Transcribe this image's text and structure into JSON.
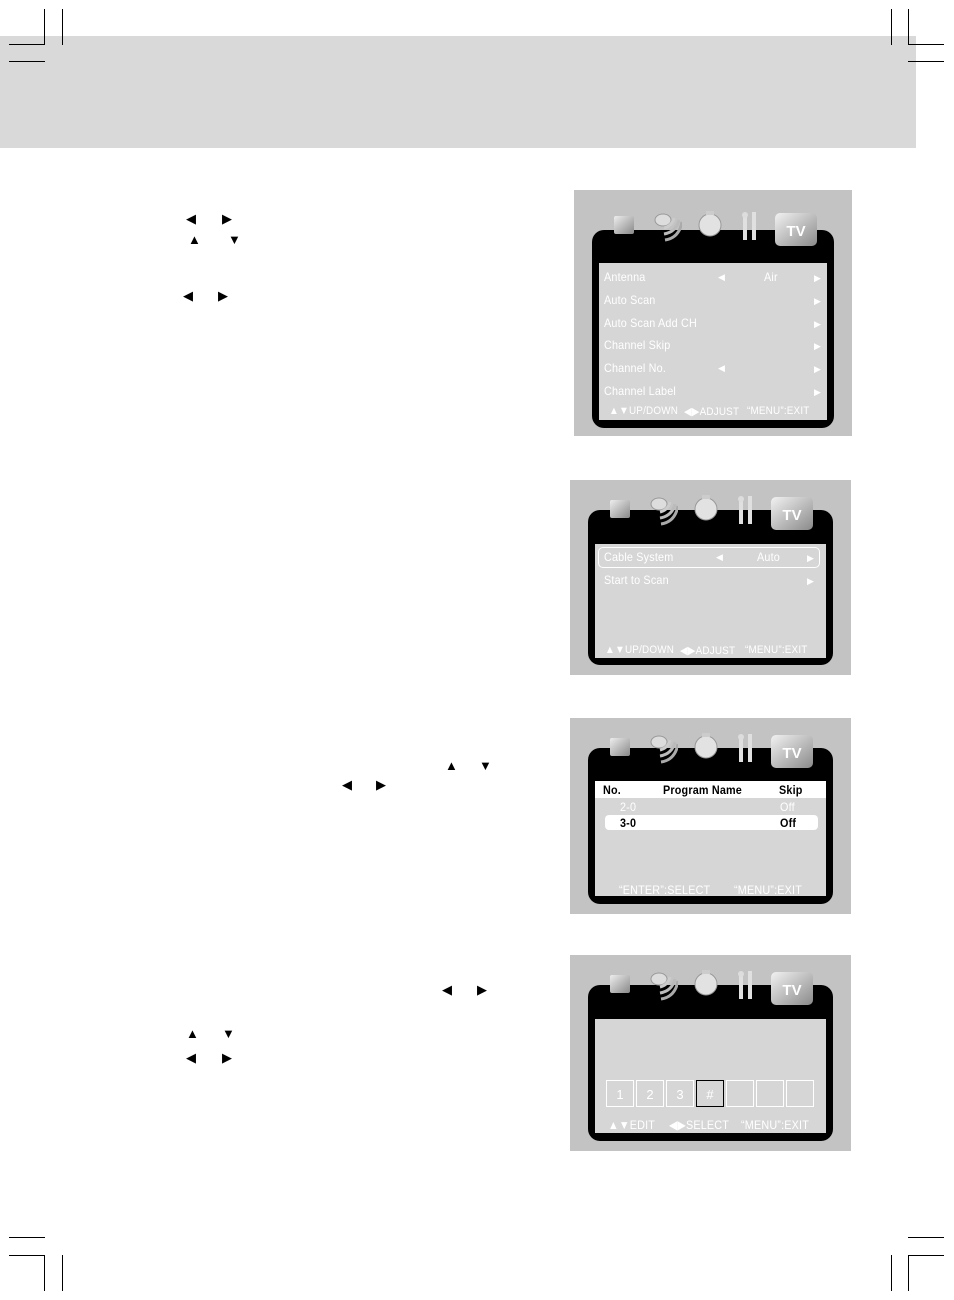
{
  "page": {
    "instruction_arrows": {
      "left": "◀",
      "right": "▶",
      "up": "▲",
      "down": "▼"
    }
  },
  "osd_icons": [
    "picture-icon",
    "sound-icon",
    "timer-icon",
    "setup-tools-icon",
    "tv-icon"
  ],
  "menu1": {
    "tv_icon_label": "TV",
    "items": [
      {
        "label": "Antenna",
        "value": "Air",
        "has_left": true
      },
      {
        "label": "Auto  Scan",
        "value": "",
        "has_left": false
      },
      {
        "label": "Auto  Scan  Add  CH",
        "value": "",
        "has_left": false
      },
      {
        "label": "Channel  Skip",
        "value": "",
        "has_left": false
      },
      {
        "label": "Channel  No.",
        "value": "",
        "has_left": true
      },
      {
        "label": "Channel  Label",
        "value": "",
        "has_left": false
      }
    ],
    "footer": {
      "updown": "▲▼UP/DOWN",
      "adjust": "◀▶ADJUST",
      "exit": "“MENU”:EXIT"
    }
  },
  "menu2": {
    "items": [
      {
        "label": "Cable System",
        "value": "Auto",
        "selected": true
      },
      {
        "label": "Start to Scan",
        "value": "",
        "selected": false
      }
    ],
    "footer": {
      "updown": "▲▼UP/DOWN",
      "adjust": "◀▶ADJUST",
      "exit": "“MENU”:EXIT"
    }
  },
  "menu3": {
    "columns": [
      "No.",
      "Program Name",
      "Skip"
    ],
    "rows": [
      {
        "no": "2-0",
        "name": "",
        "skip": "Off",
        "selected": false
      },
      {
        "no": "3-0",
        "name": "",
        "skip": "Off",
        "selected": true
      }
    ],
    "footer": {
      "select": "“ENTER”:SELECT",
      "exit": "“MENU”:EXIT"
    }
  },
  "menu4": {
    "label_chars": [
      "1",
      "2",
      "3",
      "#",
      "",
      "",
      ""
    ],
    "selected_index": 3,
    "footer": {
      "edit": "▲▼EDIT",
      "select": "◀▶SELECT",
      "exit": "“MENU”:EXIT"
    }
  }
}
